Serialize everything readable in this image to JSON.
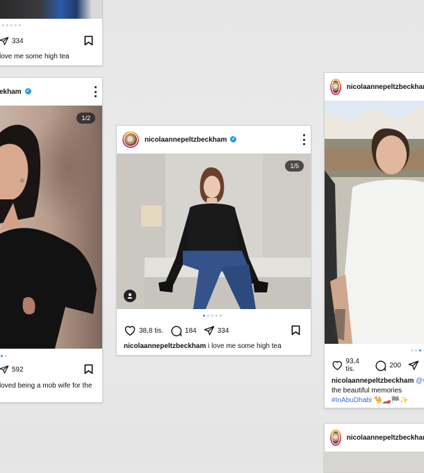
{
  "username": "nicolaannepeltzbeckham",
  "username_partial_left": "ekham",
  "cards": {
    "top_left": {
      "shares": "334",
      "caption": "love me some high tea"
    },
    "mid_left": {
      "counter": "1/2",
      "shares": "592",
      "caption": "loved being a mob wife for the"
    },
    "center": {
      "counter": "1/5",
      "likes": "38,8 tis.",
      "comments": "184",
      "shares": "334",
      "caption": "i love me some high tea"
    },
    "right": {
      "likes": "93,4 tis.",
      "comments": "200",
      "caption_mention": "@vi",
      "caption_line2": "the beautiful memories",
      "caption_tag": "#InAbuDhabi",
      "caption_emoji": "🐪🏎️🏁✨"
    },
    "bottom_right": {}
  },
  "colors": {
    "accent": "#2b8ef0",
    "verified": "#1d9bf0",
    "hashtag": "#3b6fd0"
  }
}
